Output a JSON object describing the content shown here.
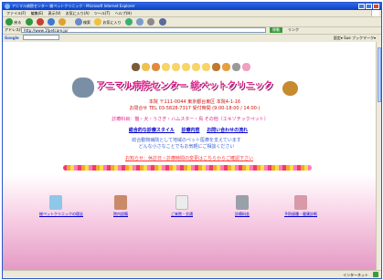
{
  "window": {
    "title": "アニマル病院センター  総ペットクリニック - Microsoft Internet Explorer",
    "menu": [
      "ファイル(F)",
      "編集(E)",
      "表示(V)",
      "お気に入り(A)",
      "ツール(T)",
      "ヘルプ(H)"
    ],
    "toolbar": {
      "back": "戻る",
      "search": "検索",
      "favorites": "お気に入り"
    },
    "address": {
      "label": "アドレス(D)",
      "url": "http://www.1fpetcare.jp/",
      "go": "移動",
      "links": "リンク"
    },
    "google": {
      "label": "Google",
      "right_text": "設定▾  Sue  ブックマーク▾"
    },
    "status": {
      "left": "",
      "zone": "インターネット"
    }
  },
  "page": {
    "clinic_title": "アニマル病院センター  総ペットクリニック",
    "address_line1": "本院 〒111-0044 東京都台東区 本院4-1-16",
    "address_line2": "お問合せ TEL 03-5828-7317 受付時間 (9:00-18:00 / 14:00-)",
    "services": "診療科目：猫・犬・うさぎ・ハムスター・鳥 その他（エキゾチックペット）",
    "nav_links": [
      "総合的な診療スタイル",
      "診療内容",
      "お問い合わせの流れ"
    ],
    "blue_line1": "総合動物病院として地域のペット医療を支えています",
    "blue_line2": "どんな小さなことでもお気軽にご相談ください",
    "red_link": "お知らせ：休診日・診療時間の変更はこちらからご確認下さい",
    "menu_items": [
      {
        "label": "総ペットクリニックの理念",
        "color": "#8fc7e8"
      },
      {
        "label": "院内設備",
        "color": "#c98a6a"
      },
      {
        "label": "ご来院・交通",
        "color": "#ececec"
      },
      {
        "label": "診療料金",
        "color": "#9aa0aa"
      },
      {
        "label": "予防接種・健康診断",
        "color": "#d89aa8"
      }
    ],
    "animal_colors": [
      "#7a5a3a",
      "#f0c050",
      "#e08a40",
      "#f7d56b",
      "#f7d56b",
      "#f7d56b",
      "#f7d56b",
      "#f7d56b",
      "#c07830",
      "#e6a040",
      "#9a9a9a",
      "#f0a0c0"
    ]
  }
}
